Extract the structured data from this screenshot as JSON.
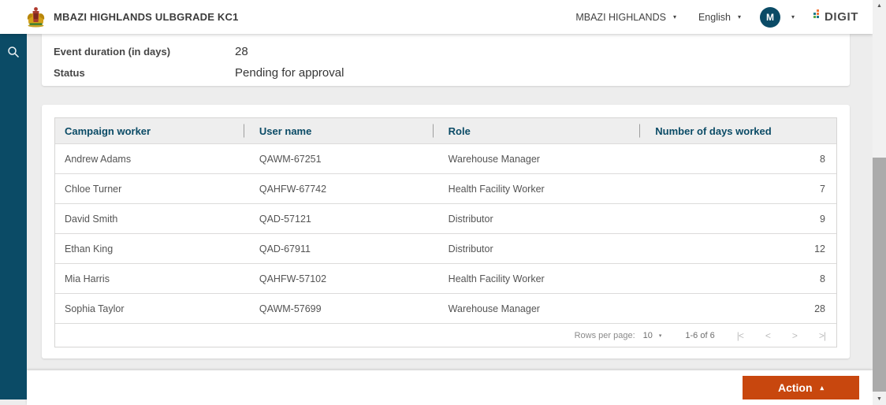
{
  "header": {
    "title": "MBAZI HIGHLANDS ULBGRADE KC1",
    "city_selector": "MBAZI HIGHLANDS",
    "language_selector": "English",
    "avatar_initial": "M",
    "brand": "DIGIT"
  },
  "icons": {
    "caret_down": "▾",
    "caret_up": "▴",
    "scroll_up": "▲",
    "scroll_down": "▼",
    "page_first": "|<",
    "page_prev": "<",
    "page_next": ">",
    "page_last": ">|"
  },
  "details": {
    "rows": [
      {
        "label": "Event duration (in days)",
        "value": "28"
      },
      {
        "label": "Status",
        "value": "Pending for approval"
      }
    ]
  },
  "table": {
    "columns": [
      "Campaign worker",
      "User name",
      "Role",
      "Number of days worked"
    ],
    "rows": [
      [
        "Andrew Adams",
        "QAWM-67251",
        "Warehouse Manager",
        "8"
      ],
      [
        "Chloe Turner",
        "QAHFW-67742",
        "Health Facility Worker",
        "7"
      ],
      [
        "David Smith",
        "QAD-57121",
        "Distributor",
        "9"
      ],
      [
        "Ethan King",
        "QAD-67911",
        "Distributor",
        "12"
      ],
      [
        "Mia Harris",
        "QAHFW-57102",
        "Health Facility Worker",
        "8"
      ],
      [
        "Sophia Taylor",
        "QAWM-57699",
        "Warehouse Manager",
        "28"
      ]
    ],
    "pagination": {
      "rows_per_page_label": "Rows per page:",
      "rows_per_page_value": "10",
      "range_label": "1-6 of 6"
    }
  },
  "footer": {
    "action_label": "Action"
  },
  "colors": {
    "primary_teal": "#0B4B66",
    "accent_orange": "#C8470E",
    "content_bg": "#EDEDED"
  }
}
